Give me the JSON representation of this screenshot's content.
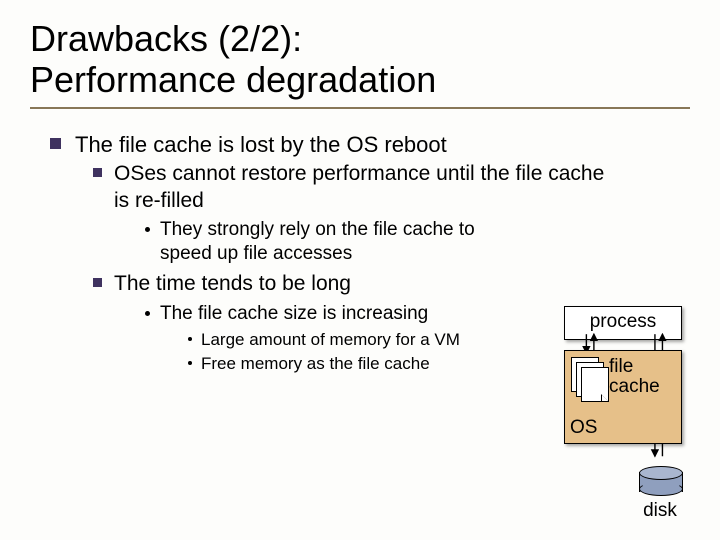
{
  "title": "Drawbacks (2/2):\nPerformance degradation",
  "bullets": {
    "b1": "The file cache is lost by the OS reboot",
    "b1_1": "OSes cannot restore performance until the file cache is re-filled",
    "b1_1_1": "They strongly rely on the file cache to speed up file accesses",
    "b1_2": "The time tends to be long",
    "b1_2_1": "The file cache size is increasing",
    "b1_2_1_1": "Large amount of memory for a VM",
    "b1_2_1_2": "Free memory as the file cache"
  },
  "diagram": {
    "process": "process",
    "file_cache": "file\ncache",
    "os": "OS",
    "disk": "disk"
  }
}
